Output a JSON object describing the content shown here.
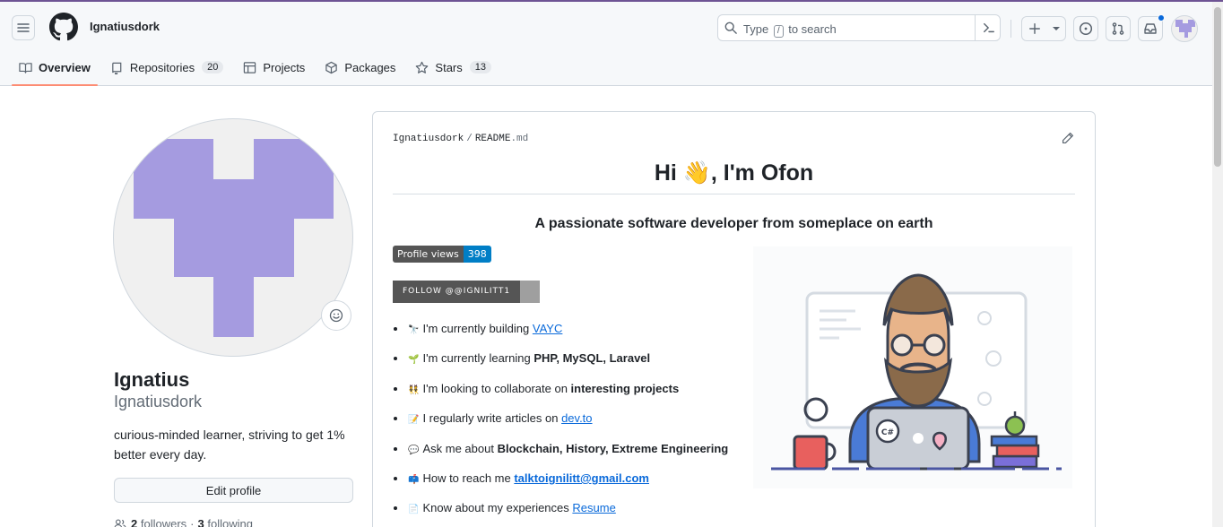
{
  "header": {
    "owner": "Ignatiusdork",
    "search_prefix": "Type",
    "search_key": "/",
    "search_suffix": "to search"
  },
  "tabs": [
    {
      "label": "Overview",
      "active": true
    },
    {
      "label": "Repositories",
      "count": "20"
    },
    {
      "label": "Projects"
    },
    {
      "label": "Packages"
    },
    {
      "label": "Stars",
      "count": "13"
    }
  ],
  "profile": {
    "name": "Ignatius",
    "login": "Ignatiusdork",
    "bio": "curious-minded learner, striving to get 1% better every day.",
    "edit_label": "Edit profile",
    "followers_count": "2",
    "followers_label": "followers",
    "separator": "·",
    "following_count": "3",
    "following_label": "following"
  },
  "readme": {
    "path_owner": "Ignatiusdork",
    "path_sep": "/",
    "path_file": "README",
    "path_ext": ".md",
    "heading": "Hi 👋, I'm Ofon",
    "subheading": "A passionate software developer from someplace on earth",
    "badge_label": "Profile views",
    "badge_value": "398",
    "follow_badge": "FOLLOW @@IGNILITT1",
    "items": [
      {
        "emoji": "🔭",
        "text": "I'm currently building ",
        "link": "VAYC"
      },
      {
        "emoji": "🌱",
        "text": "I'm currently learning ",
        "bold": "PHP, MySQL, Laravel"
      },
      {
        "emoji": "👯",
        "text": "I'm looking to collaborate on ",
        "bold": "interesting projects"
      },
      {
        "emoji": "📝",
        "text": "I regularly write articles on ",
        "link": "dev.to"
      },
      {
        "emoji": "💬",
        "text": "Ask me about ",
        "bold": "Blockchain, History, Extreme Engineering"
      },
      {
        "emoji": "📫",
        "text": "How to reach me ",
        "boldlink": "talktoignilitt@gmail.com"
      },
      {
        "emoji": "📄",
        "text": "Know about my experiences ",
        "link": "Resume"
      }
    ],
    "laptop_text": "C#",
    "mug_text": "JS"
  },
  "colors": {
    "avatar_purple": "#a59be0",
    "accent_blue": "#0969da",
    "tab_underline": "#fd8c73"
  }
}
